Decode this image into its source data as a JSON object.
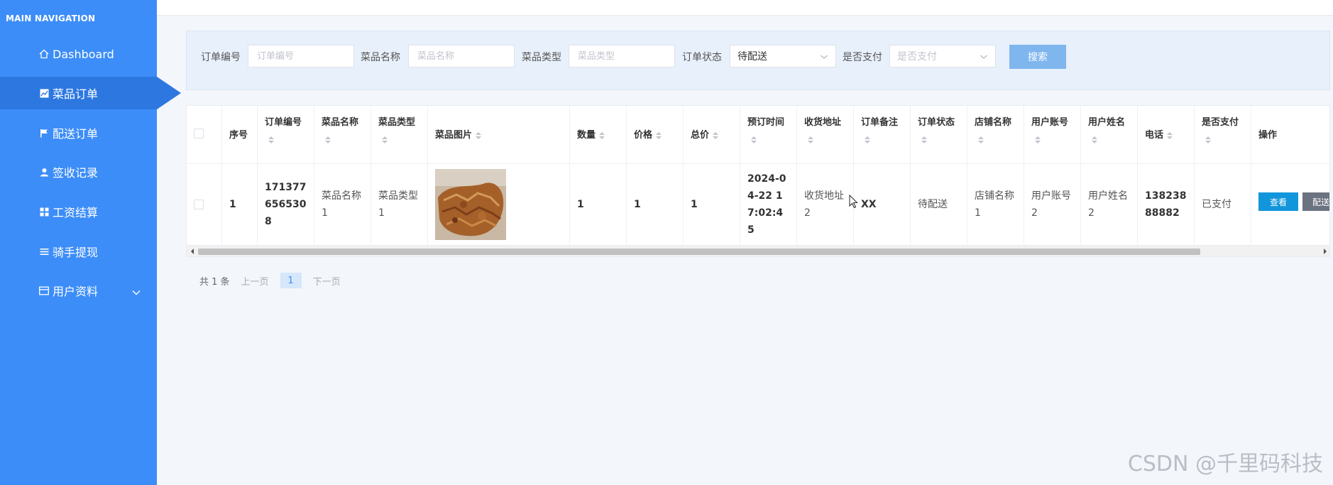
{
  "sidebar": {
    "heading": "MAIN NAVIGATION",
    "items": [
      {
        "label": "Dashboard",
        "icon": "home-icon"
      },
      {
        "label": "菜品订单",
        "icon": "chart-icon",
        "active": true
      },
      {
        "label": "配送订单",
        "icon": "flag-icon"
      },
      {
        "label": "签收记录",
        "icon": "user-icon"
      },
      {
        "label": "工资结算",
        "icon": "grid-icon"
      },
      {
        "label": "骑手提现",
        "icon": "list-icon"
      },
      {
        "label": "用户资料",
        "icon": "card-icon",
        "expandable": true
      }
    ],
    "color": "#3c8df8"
  },
  "search": {
    "order_no_label": "订单编号",
    "order_no_placeholder": "订单编号",
    "dish_name_label": "菜品名称",
    "dish_name_placeholder": "菜品名称",
    "dish_type_label": "菜品类型",
    "dish_type_placeholder": "菜品类型",
    "status_label": "订单状态",
    "status_value": "待配送",
    "paid_label": "是否支付",
    "paid_placeholder": "是否支付",
    "search_button": "搜索"
  },
  "table": {
    "headers": [
      "序号",
      "订单编号",
      "菜品名称",
      "菜品类型",
      "菜品图片",
      "数量",
      "价格",
      "总价",
      "预订时间",
      "收货地址",
      "订单备注",
      "订单状态",
      "店铺名称",
      "用户账号",
      "用户姓名",
      "电话",
      "是否支付",
      "操作"
    ],
    "row": {
      "index": "1",
      "order_no": "1713776565308",
      "dish_name": "菜品名称1",
      "dish_type": "菜品类型1",
      "quantity": "1",
      "price": "1",
      "total": "1",
      "reserve_time": "2024-04-22 17:02:45",
      "address": "收货地址2",
      "remark": "XX",
      "status": "待配送",
      "shop_name": "店铺名称1",
      "user_account": "用户账号2",
      "user_name": "用户姓名2",
      "phone": "13823888882",
      "paid": "已支付",
      "view_button": "查看",
      "deliver_button": "配送"
    }
  },
  "pagination": {
    "total": "共 1 条",
    "prev": "上一页",
    "current": "1",
    "next": "下一页"
  },
  "watermark": "CSDN @千里码科技"
}
